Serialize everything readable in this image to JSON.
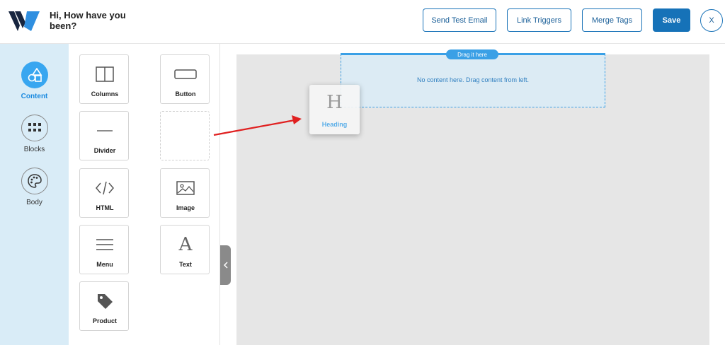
{
  "header": {
    "greeting": "Hi, How have you been?",
    "buttons": {
      "send_test_email": "Send Test Email",
      "link_triggers": "Link Triggers",
      "merge_tags": "Merge Tags",
      "save": "Save",
      "close": "X"
    }
  },
  "sidebar": {
    "items": [
      {
        "label": "Content",
        "icon": "shapes-icon",
        "active": true
      },
      {
        "label": "Blocks",
        "icon": "grid-icon",
        "active": false
      },
      {
        "label": "Body",
        "icon": "palette-icon",
        "active": false
      }
    ]
  },
  "tools": {
    "tiles": [
      {
        "label": "Columns",
        "icon": "columns-icon"
      },
      {
        "label": "Button",
        "icon": "button-icon"
      },
      {
        "label": "Divider",
        "icon": "divider-icon"
      },
      {
        "label": "",
        "icon": "empty-slot"
      },
      {
        "label": "HTML",
        "icon": "code-icon"
      },
      {
        "label": "Image",
        "icon": "image-icon"
      },
      {
        "label": "Menu",
        "icon": "menu-icon"
      },
      {
        "label": "Text",
        "icon": "text-icon"
      },
      {
        "label": "Product",
        "icon": "tag-icon"
      }
    ]
  },
  "canvas": {
    "drag_pill": "Drag it here",
    "drop_text": "No content here. Drag content from left."
  },
  "drag_ghost": {
    "glyph": "H",
    "label": "Heading"
  },
  "colors": {
    "accent": "#1672b8",
    "sidebar_bg": "#d9ecf7",
    "drop_zone": "#3aa0e6",
    "arrow": "#e02020"
  }
}
